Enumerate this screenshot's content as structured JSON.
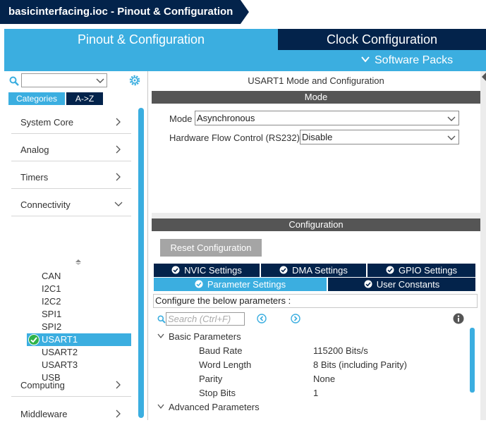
{
  "titlebar": {
    "title": "basicinterfacing.ioc - Pinout & Configuration"
  },
  "main_tabs": {
    "pinout": "Pinout & Configuration",
    "clock": "Clock Configuration",
    "software_packs": "Software Packs"
  },
  "left": {
    "search_value": "",
    "tabs": {
      "categories": "Categories",
      "atoz": "A->Z"
    },
    "categories": [
      "System Core",
      "Analog",
      "Timers",
      "Connectivity",
      "Computing",
      "Middleware"
    ],
    "connectivity_items": [
      "CAN",
      "I2C1",
      "I2C2",
      "SPI1",
      "SPI2",
      "USART1",
      "USART2",
      "USART3",
      "USB"
    ],
    "selected": "USART1"
  },
  "mode": {
    "header": "USART1 Mode and Configuration",
    "band": "Mode",
    "mode_label": "Mode",
    "mode_value": "Asynchronous",
    "hwflow_label": "Hardware Flow Control (RS232)",
    "hwflow_value": "Disable"
  },
  "config": {
    "band": "Configuration",
    "reset_label": "Reset Configuration",
    "tabs_row1": [
      "NVIC Settings",
      "DMA Settings",
      "GPIO Settings"
    ],
    "tabs_row2": [
      "Parameter Settings",
      "User Constants"
    ],
    "description": "Configure the below parameters :",
    "search_placeholder": "Search (Ctrl+F)",
    "groups": {
      "basic": "Basic Parameters",
      "advanced": "Advanced Parameters"
    },
    "params": [
      {
        "name": "Baud Rate",
        "value": "115200 Bits/s"
      },
      {
        "name": "Word Length",
        "value": "8 Bits (including Parity)"
      },
      {
        "name": "Parity",
        "value": "None"
      },
      {
        "name": "Stop Bits",
        "value": "1"
      }
    ]
  },
  "colors": {
    "accent": "#3baee0",
    "navy": "#03234b",
    "band": "#555555",
    "check": "#2fb34a"
  }
}
